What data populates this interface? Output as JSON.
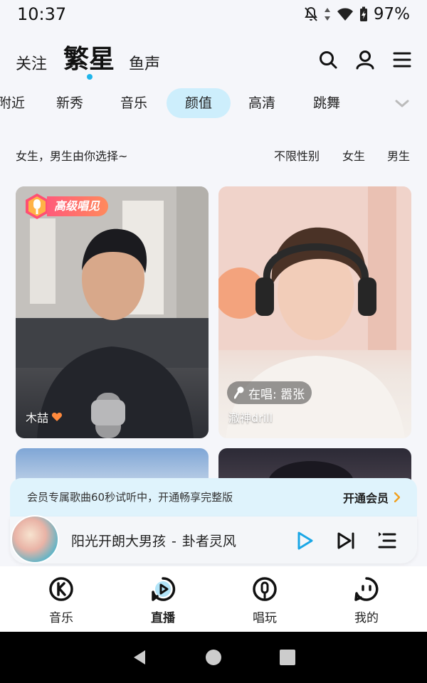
{
  "status": {
    "time": "10:37",
    "battery": "97%"
  },
  "nav": {
    "follow": "关注",
    "stars": "繁星",
    "fishvoice": "鱼声"
  },
  "categories": [
    "附近",
    "新秀",
    "音乐",
    "颜值",
    "高清",
    "跳舞"
  ],
  "active_category": "颜值",
  "filter": {
    "hint": "女生，男生由你选择~",
    "options": [
      "不限性别",
      "女生",
      "男生"
    ]
  },
  "cards": [
    {
      "badge": "高级唱见",
      "name": "木喆"
    },
    {
      "singing": "在唱: 嚣张",
      "name": "澈神drill"
    }
  ],
  "member": {
    "text": "会员专属歌曲60秒试听中，开通畅享完整版",
    "cta": "开通会员"
  },
  "player": {
    "song": "阳光开朗大男孩",
    "separator": "-",
    "artist": "卦者灵风"
  },
  "bottom_tabs": [
    {
      "label": "音乐",
      "icon": "music-k-icon"
    },
    {
      "label": "直播",
      "icon": "live-icon"
    },
    {
      "label": "唱玩",
      "icon": "mic-play-icon"
    },
    {
      "label": "我的",
      "icon": "smiley-icon"
    }
  ],
  "active_tab": "直播",
  "colors": {
    "accent": "#1fb5ea",
    "chip": "#cdeefc",
    "banner": "#dff3fc",
    "player_blue": "#1aa7e6"
  }
}
